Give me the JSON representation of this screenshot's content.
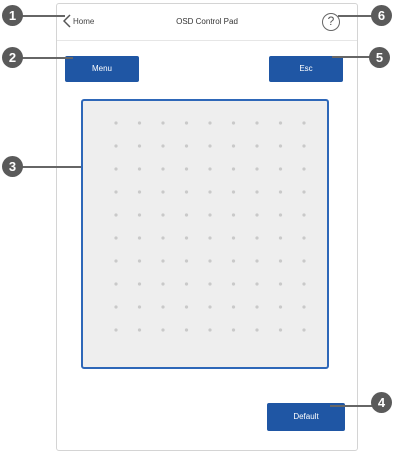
{
  "topbar": {
    "back_label": "Home",
    "title": "OSD Control Pad",
    "help_symbol": "?"
  },
  "buttons": {
    "menu_label": "Menu",
    "esc_label": "Esc",
    "default_label": "Default"
  },
  "callouts": [
    "1",
    "2",
    "3",
    "4",
    "5",
    "6"
  ],
  "colors": {
    "button_blue": "#1f56a4",
    "pad_border": "#2e67b8",
    "pad_bg": "#eeeeee",
    "dot": "#c9c9c9",
    "callout": "#5a5a5a"
  }
}
